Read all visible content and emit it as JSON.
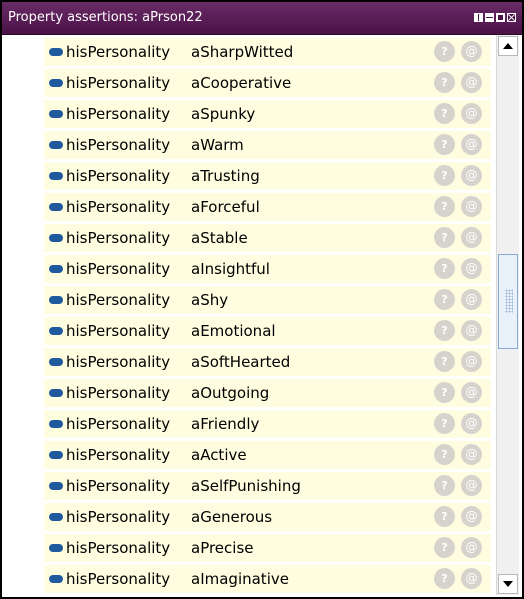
{
  "window": {
    "title": "Property assertions: aPrson22"
  },
  "buttons": {
    "help_glyph": "?",
    "annotate_glyph": "@"
  },
  "colors": {
    "titlebar": "#4a1247",
    "row_background": "#fffde0",
    "property_icon": "#1f5a9e",
    "button_gray": "#d6d3cd"
  },
  "assertions": [
    {
      "property": "hisPersonality",
      "value": "aSharpWitted"
    },
    {
      "property": "hisPersonality",
      "value": "aCooperative"
    },
    {
      "property": "hisPersonality",
      "value": "aSpunky"
    },
    {
      "property": "hisPersonality",
      "value": "aWarm"
    },
    {
      "property": "hisPersonality",
      "value": "aTrusting"
    },
    {
      "property": "hisPersonality",
      "value": "aForceful"
    },
    {
      "property": "hisPersonality",
      "value": "aStable"
    },
    {
      "property": "hisPersonality",
      "value": "aInsightful"
    },
    {
      "property": "hisPersonality",
      "value": "aShy"
    },
    {
      "property": "hisPersonality",
      "value": "aEmotional"
    },
    {
      "property": "hisPersonality",
      "value": "aSoftHearted"
    },
    {
      "property": "hisPersonality",
      "value": "aOutgoing"
    },
    {
      "property": "hisPersonality",
      "value": "aFriendly"
    },
    {
      "property": "hisPersonality",
      "value": "aActive"
    },
    {
      "property": "hisPersonality",
      "value": "aSelfPunishing"
    },
    {
      "property": "hisPersonality",
      "value": "aGenerous"
    },
    {
      "property": "hisPersonality",
      "value": "aPrecise"
    },
    {
      "property": "hisPersonality",
      "value": "aImaginative"
    }
  ]
}
